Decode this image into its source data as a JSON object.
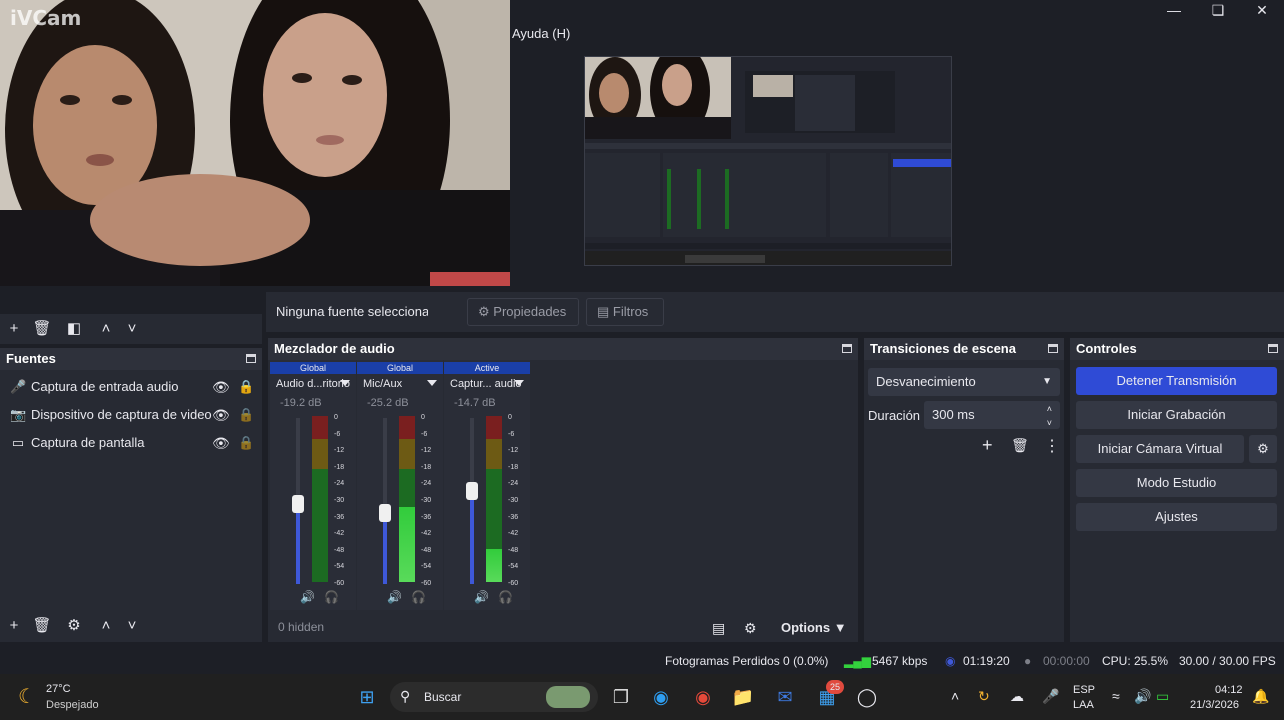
{
  "window": {
    "minimize_icon": "minimize-icon",
    "maximize_icon": "maximize-icon",
    "close_icon": "close-icon",
    "menu_help": "Ayuda (H)"
  },
  "webcam": {
    "watermark": "iVCam"
  },
  "sources_selection": {
    "no_source": "Ninguna fuente seleccionad",
    "properties_label": "Propiedades",
    "filters_label": "Filtros"
  },
  "sources": {
    "title": "Fuentes",
    "items": [
      {
        "label": "Captura de entrada audio",
        "icon": "microphone-icon"
      },
      {
        "label": "Dispositivo de captura de video",
        "icon": "camera-icon"
      },
      {
        "label": "Captura de pantalla",
        "icon": "monitor-icon"
      }
    ]
  },
  "mixer": {
    "title": "Mezclador de audio",
    "channels": [
      {
        "tag": "Global",
        "name": "Audio d...ritorio",
        "db": "-19.2 dB",
        "volume": 0.48,
        "level": 0.0
      },
      {
        "tag": "Global",
        "name": "Mic/Aux",
        "db": "-25.2 dB",
        "volume": 0.43,
        "level": 0.45
      },
      {
        "tag": "Active",
        "name": "Captur... audio",
        "db": "-14.7 dB",
        "volume": 0.56,
        "level": 0.2
      }
    ],
    "ticks": [
      "0",
      "-6",
      "-12",
      "-18",
      "-24",
      "-30",
      "-36",
      "-42",
      "-48",
      "-54",
      "-60"
    ],
    "hidden_label": "0 hidden",
    "options_label": "Options"
  },
  "transitions": {
    "title": "Transiciones de escena",
    "selected": "Desvanecimiento",
    "duration_label": "Duración",
    "duration_value": "300 ms"
  },
  "controls": {
    "title": "Controles",
    "stop_stream": "Detener Transmisión",
    "start_recording": "Iniciar Grabación",
    "start_virtual_cam": "Iniciar Cámara Virtual",
    "studio_mode": "Modo Estudio",
    "settings": "Ajustes"
  },
  "status": {
    "dropped_frames": "Fotogramas Perdidos 0 (0.0%)",
    "bitrate": "5467 kbps",
    "stream_time": "01:19:20",
    "rec_time": "00:00:00",
    "cpu": "CPU: 25.5%",
    "fps": "30.00 / 30.00 FPS"
  },
  "taskbar": {
    "weather_temp": "27°C",
    "weather_desc": "Despejado",
    "search_label": "Buscar",
    "badge_count": "25",
    "lang_top": "ESP",
    "lang_bottom": "LAA",
    "time": "04:12",
    "date": "21/3/2026"
  },
  "colors": {
    "accent": "#3e58d8",
    "stream_button": "#2f4bd6",
    "panel": "#272a33",
    "background": "#1d1f26"
  }
}
